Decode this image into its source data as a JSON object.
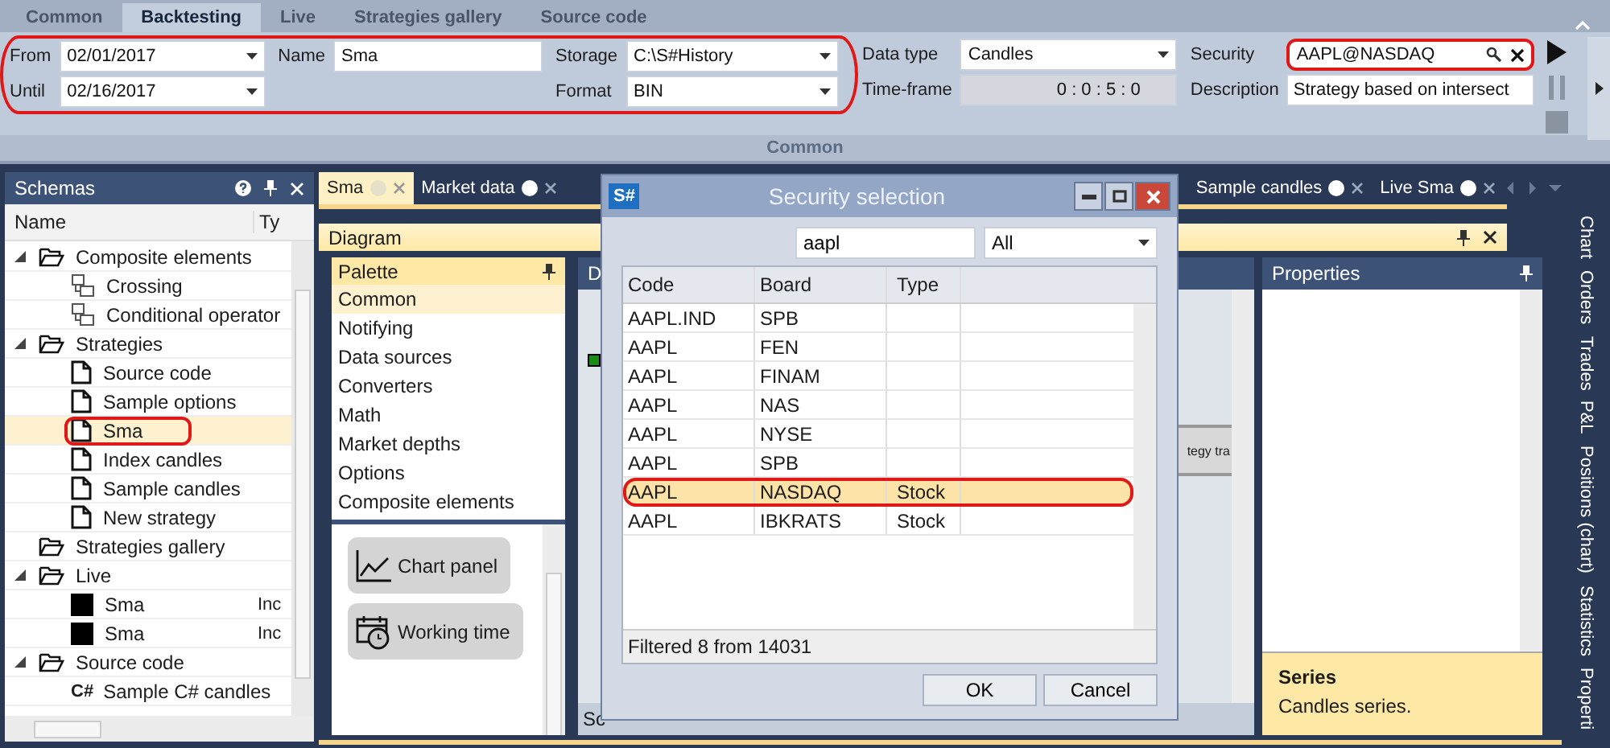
{
  "ribbon_tabs": [
    {
      "label": "Common",
      "selected": false
    },
    {
      "label": "Backtesting",
      "selected": true
    },
    {
      "label": "Live",
      "selected": false
    },
    {
      "label": "Strategies gallery",
      "selected": false
    },
    {
      "label": "Source code",
      "selected": false
    }
  ],
  "ribbon": {
    "groups": [
      {
        "circled": true,
        "columns": [
          [
            {
              "label": "From",
              "value": "02/01/2017",
              "kind": "dropdown"
            },
            {
              "label": "Until",
              "value": "02/16/2017",
              "kind": "dropdown"
            }
          ],
          [
            {
              "label": "Name",
              "value": "Sma",
              "kind": "text"
            }
          ],
          [
            {
              "label": "Storage",
              "value": "C:\\S#History",
              "kind": "dropdown"
            },
            {
              "label": "Format",
              "value": "BIN",
              "kind": "dropdown"
            }
          ]
        ]
      },
      {
        "columns": [
          [
            {
              "label": "Data type",
              "value": "Candles",
              "kind": "dropdown"
            },
            {
              "label": "Time-frame",
              "value": "0 : 0 : 5 : 0",
              "kind": "spinner"
            }
          ],
          [
            {
              "label": "Security",
              "value": "AAPL@NASDAQ",
              "kind": "search",
              "circled": true
            },
            {
              "label": "Description",
              "value": "Strategy based on intersect",
              "kind": "text"
            }
          ]
        ]
      }
    ],
    "group_label": "Common"
  },
  "schemas": {
    "title": "Schemas",
    "columns": [
      "Name",
      "Ty"
    ],
    "items": [
      {
        "label": "Composite elements",
        "kind": "folder",
        "expanded": true,
        "selected": false,
        "children": [
          {
            "label": "Crossing",
            "kind": "composite",
            "selected": false
          },
          {
            "label": "Conditional operator",
            "kind": "composite",
            "selected": false
          }
        ]
      },
      {
        "label": "Strategies",
        "kind": "folder",
        "expanded": true,
        "selected": false,
        "children": [
          {
            "label": "Source code",
            "kind": "page",
            "selected": false
          },
          {
            "label": "Sample options",
            "kind": "page",
            "selected": false
          },
          {
            "label": "Sma",
            "kind": "page",
            "selected": true,
            "circled": true
          },
          {
            "label": "Index candles",
            "kind": "page",
            "selected": false
          },
          {
            "label": "Sample candles",
            "kind": "page",
            "selected": false
          },
          {
            "label": "New strategy",
            "kind": "page",
            "selected": false
          }
        ]
      },
      {
        "label": "Strategies gallery",
        "kind": "folder",
        "selected": false
      },
      {
        "label": "Live",
        "kind": "folder",
        "expanded": true,
        "selected": false,
        "children": [
          {
            "label": "Sma",
            "kind": "live",
            "type": "Inc",
            "selected": false
          },
          {
            "label": "Sma",
            "kind": "live",
            "type": "Inc",
            "selected": false
          }
        ]
      },
      {
        "label": "Source code",
        "kind": "folder",
        "expanded": true,
        "selected": false,
        "children": [
          {
            "label": "Sample C# candles",
            "kind": "code",
            "badge": "C#",
            "selected": false
          }
        ]
      }
    ]
  },
  "doc_tabs": [
    {
      "label": "Sma",
      "selected": true
    },
    {
      "label": "Market data",
      "selected": false
    },
    {
      "label": "Sample candles",
      "selected": false
    },
    {
      "label": "Live Sma",
      "selected": false
    }
  ],
  "diagram_bar": "Diagram",
  "palette": {
    "title": "Palette",
    "categories": [
      {
        "label": "Common",
        "selected": true
      },
      {
        "label": "Notifying",
        "selected": false
      },
      {
        "label": "Data sources",
        "selected": false
      },
      {
        "label": "Converters",
        "selected": false
      },
      {
        "label": "Math",
        "selected": false
      },
      {
        "label": "Market depths",
        "selected": false
      },
      {
        "label": "Options",
        "selected": false
      },
      {
        "label": "Composite elements",
        "selected": false
      }
    ],
    "elements": [
      {
        "label": "Chart panel",
        "kind": "chart"
      },
      {
        "label": "Working time",
        "kind": "calendar"
      }
    ]
  },
  "diagram": {
    "title": "D",
    "node_text": "tegy tra",
    "footer": "Sc"
  },
  "properties": {
    "title": "Properties",
    "help_title": "Series",
    "help_text": "Candles series."
  },
  "side_tabs": [
    "Chart",
    "Orders",
    "Trades",
    "P&L",
    "Positions (chart)",
    "Statistics",
    "Properti"
  ],
  "dialog": {
    "logo": "S#",
    "title": "Security selection",
    "search": "aapl",
    "filter": "All",
    "columns": [
      "Code",
      "Board",
      "Type"
    ],
    "rows": [
      {
        "code": "AAPL.IND",
        "board": "SPB",
        "selected": false
      },
      {
        "code": "AAPL",
        "board": "FEN",
        "selected": false
      },
      {
        "code": "AAPL",
        "board": "FINAM",
        "selected": false
      },
      {
        "code": "AAPL",
        "board": "NAS",
        "selected": false
      },
      {
        "code": "AAPL",
        "board": "NYSE",
        "selected": false
      },
      {
        "code": "AAPL",
        "board": "SPB",
        "selected": false
      },
      {
        "code": "AAPL",
        "board": "NASDAQ",
        "type": "Stock",
        "selected": true,
        "circled": true
      },
      {
        "code": "AAPL",
        "board": "IBKRATS",
        "type": "Stock",
        "selected": false
      }
    ],
    "status": "Filtered 8 from 14031",
    "buttons": [
      "OK",
      "Cancel"
    ]
  }
}
